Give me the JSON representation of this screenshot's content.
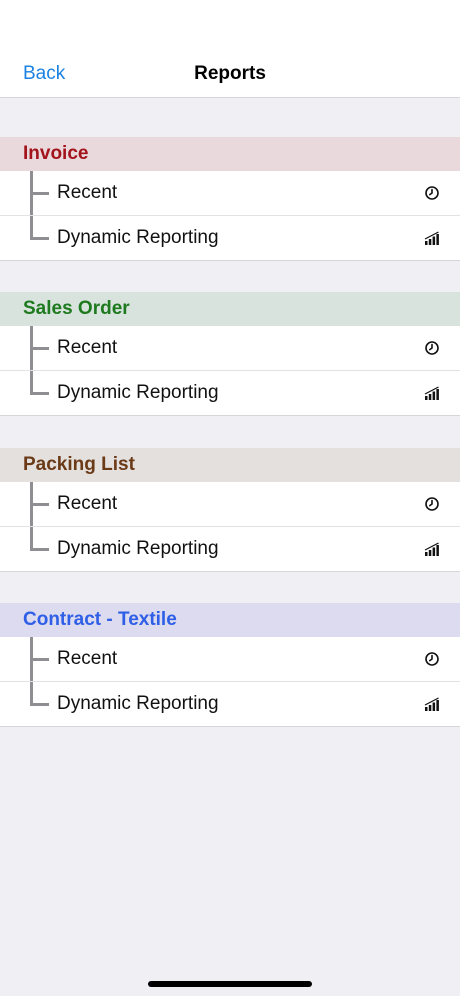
{
  "nav": {
    "back_label": "Back",
    "title": "Reports"
  },
  "sections": [
    {
      "title": "Invoice",
      "title_color": "#a3131c",
      "header_bg": "#e9d9dc",
      "items": [
        {
          "label": "Recent",
          "icon": "clock-icon"
        },
        {
          "label": "Dynamic Reporting",
          "icon": "signal-bars-icon"
        }
      ]
    },
    {
      "title": "Sales Order",
      "title_color": "#1e7a1e",
      "header_bg": "#d8e3de",
      "items": [
        {
          "label": "Recent",
          "icon": "clock-icon"
        },
        {
          "label": "Dynamic Reporting",
          "icon": "signal-bars-icon"
        }
      ]
    },
    {
      "title": "Packing List",
      "title_color": "#6b3a17",
      "header_bg": "#e4e0de",
      "items": [
        {
          "label": "Recent",
          "icon": "clock-icon"
        },
        {
          "label": "Dynamic Reporting",
          "icon": "signal-bars-icon"
        }
      ]
    },
    {
      "title": "Contract - Textile",
      "title_color": "#2f5fe6",
      "header_bg": "#dcdbef",
      "items": [
        {
          "label": "Recent",
          "icon": "clock-icon"
        },
        {
          "label": "Dynamic Reporting",
          "icon": "signal-bars-icon"
        }
      ]
    }
  ]
}
